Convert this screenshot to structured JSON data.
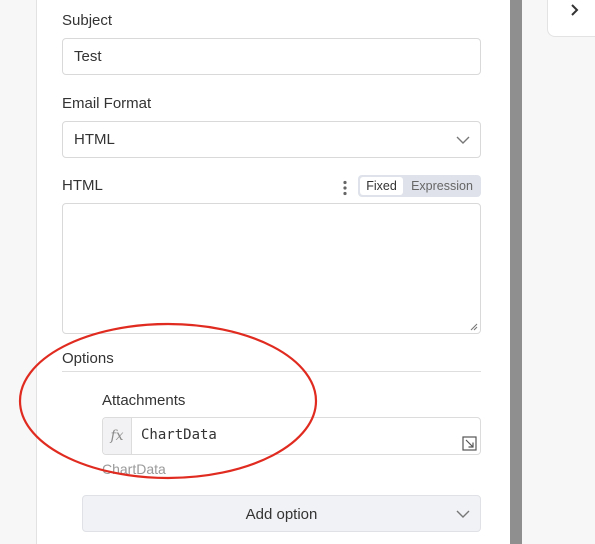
{
  "subject": {
    "label": "Subject",
    "value": "Test"
  },
  "email_format": {
    "label": "Email Format",
    "value": "HTML"
  },
  "html_field": {
    "label": "HTML",
    "mode_fixed": "Fixed",
    "mode_expression": "Expression",
    "mode_selected": "Fixed",
    "value": ""
  },
  "options": {
    "title": "Options",
    "attachments": {
      "label": "Attachments",
      "fx": "fx",
      "expression": "ChartData",
      "result": "ChartData"
    },
    "add_option_label": "Add option"
  },
  "colors": {
    "annotation_circle": "#e02b20",
    "toggle_bg": "#dfe2ea",
    "divider": "#8f8f8f"
  }
}
